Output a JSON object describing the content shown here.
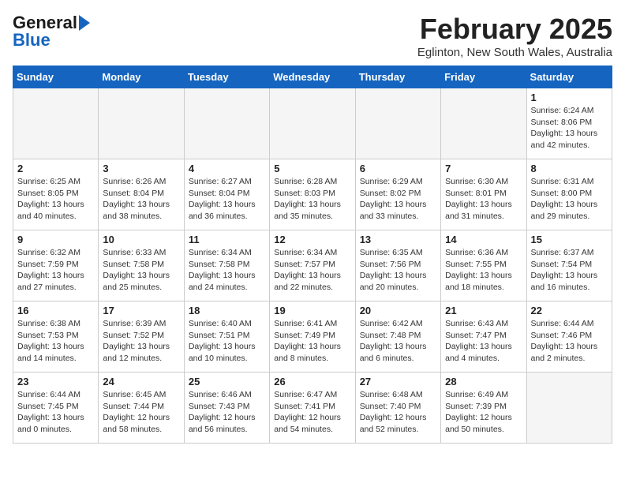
{
  "header": {
    "logo_line1": "General",
    "logo_line2": "Blue",
    "title": "February 2025",
    "subtitle": "Eglinton, New South Wales, Australia"
  },
  "days_of_week": [
    "Sunday",
    "Monday",
    "Tuesday",
    "Wednesday",
    "Thursday",
    "Friday",
    "Saturday"
  ],
  "weeks": [
    [
      {
        "day": "",
        "info": ""
      },
      {
        "day": "",
        "info": ""
      },
      {
        "day": "",
        "info": ""
      },
      {
        "day": "",
        "info": ""
      },
      {
        "day": "",
        "info": ""
      },
      {
        "day": "",
        "info": ""
      },
      {
        "day": "1",
        "info": "Sunrise: 6:24 AM\nSunset: 8:06 PM\nDaylight: 13 hours and 42 minutes."
      }
    ],
    [
      {
        "day": "2",
        "info": "Sunrise: 6:25 AM\nSunset: 8:05 PM\nDaylight: 13 hours and 40 minutes."
      },
      {
        "day": "3",
        "info": "Sunrise: 6:26 AM\nSunset: 8:04 PM\nDaylight: 13 hours and 38 minutes."
      },
      {
        "day": "4",
        "info": "Sunrise: 6:27 AM\nSunset: 8:04 PM\nDaylight: 13 hours and 36 minutes."
      },
      {
        "day": "5",
        "info": "Sunrise: 6:28 AM\nSunset: 8:03 PM\nDaylight: 13 hours and 35 minutes."
      },
      {
        "day": "6",
        "info": "Sunrise: 6:29 AM\nSunset: 8:02 PM\nDaylight: 13 hours and 33 minutes."
      },
      {
        "day": "7",
        "info": "Sunrise: 6:30 AM\nSunset: 8:01 PM\nDaylight: 13 hours and 31 minutes."
      },
      {
        "day": "8",
        "info": "Sunrise: 6:31 AM\nSunset: 8:00 PM\nDaylight: 13 hours and 29 minutes."
      }
    ],
    [
      {
        "day": "9",
        "info": "Sunrise: 6:32 AM\nSunset: 7:59 PM\nDaylight: 13 hours and 27 minutes."
      },
      {
        "day": "10",
        "info": "Sunrise: 6:33 AM\nSunset: 7:58 PM\nDaylight: 13 hours and 25 minutes."
      },
      {
        "day": "11",
        "info": "Sunrise: 6:34 AM\nSunset: 7:58 PM\nDaylight: 13 hours and 24 minutes."
      },
      {
        "day": "12",
        "info": "Sunrise: 6:34 AM\nSunset: 7:57 PM\nDaylight: 13 hours and 22 minutes."
      },
      {
        "day": "13",
        "info": "Sunrise: 6:35 AM\nSunset: 7:56 PM\nDaylight: 13 hours and 20 minutes."
      },
      {
        "day": "14",
        "info": "Sunrise: 6:36 AM\nSunset: 7:55 PM\nDaylight: 13 hours and 18 minutes."
      },
      {
        "day": "15",
        "info": "Sunrise: 6:37 AM\nSunset: 7:54 PM\nDaylight: 13 hours and 16 minutes."
      }
    ],
    [
      {
        "day": "16",
        "info": "Sunrise: 6:38 AM\nSunset: 7:53 PM\nDaylight: 13 hours and 14 minutes."
      },
      {
        "day": "17",
        "info": "Sunrise: 6:39 AM\nSunset: 7:52 PM\nDaylight: 13 hours and 12 minutes."
      },
      {
        "day": "18",
        "info": "Sunrise: 6:40 AM\nSunset: 7:51 PM\nDaylight: 13 hours and 10 minutes."
      },
      {
        "day": "19",
        "info": "Sunrise: 6:41 AM\nSunset: 7:49 PM\nDaylight: 13 hours and 8 minutes."
      },
      {
        "day": "20",
        "info": "Sunrise: 6:42 AM\nSunset: 7:48 PM\nDaylight: 13 hours and 6 minutes."
      },
      {
        "day": "21",
        "info": "Sunrise: 6:43 AM\nSunset: 7:47 PM\nDaylight: 13 hours and 4 minutes."
      },
      {
        "day": "22",
        "info": "Sunrise: 6:44 AM\nSunset: 7:46 PM\nDaylight: 13 hours and 2 minutes."
      }
    ],
    [
      {
        "day": "23",
        "info": "Sunrise: 6:44 AM\nSunset: 7:45 PM\nDaylight: 13 hours and 0 minutes."
      },
      {
        "day": "24",
        "info": "Sunrise: 6:45 AM\nSunset: 7:44 PM\nDaylight: 12 hours and 58 minutes."
      },
      {
        "day": "25",
        "info": "Sunrise: 6:46 AM\nSunset: 7:43 PM\nDaylight: 12 hours and 56 minutes."
      },
      {
        "day": "26",
        "info": "Sunrise: 6:47 AM\nSunset: 7:41 PM\nDaylight: 12 hours and 54 minutes."
      },
      {
        "day": "27",
        "info": "Sunrise: 6:48 AM\nSunset: 7:40 PM\nDaylight: 12 hours and 52 minutes."
      },
      {
        "day": "28",
        "info": "Sunrise: 6:49 AM\nSunset: 7:39 PM\nDaylight: 12 hours and 50 minutes."
      },
      {
        "day": "",
        "info": ""
      }
    ]
  ]
}
